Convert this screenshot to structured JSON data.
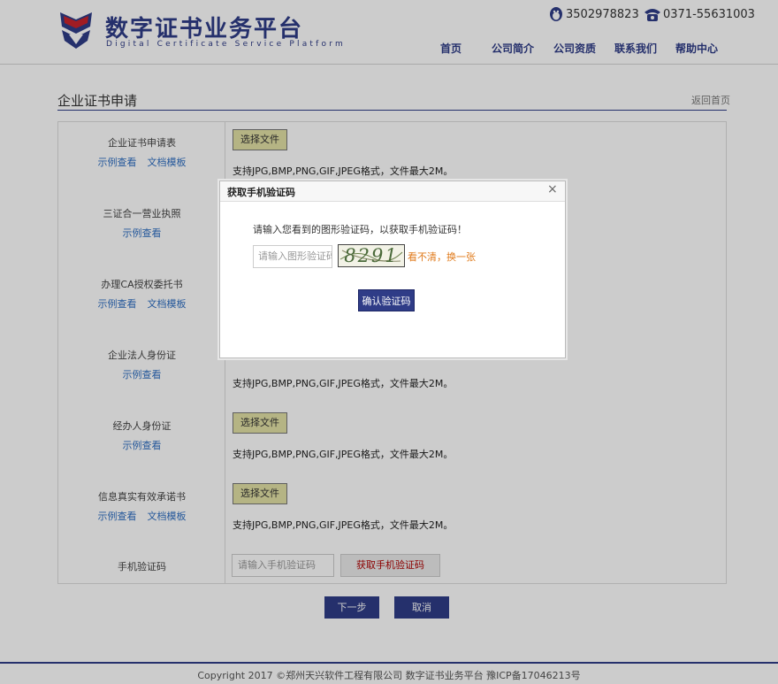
{
  "header": {
    "brand_title": "数字证书业务平台",
    "brand_subtitle": "Digital Certificate Service Platform",
    "qq": "3502978823",
    "phone": "0371-55631003",
    "nav": [
      "首页",
      "公司简介",
      "公司资质",
      "联系我们",
      "帮助中心"
    ]
  },
  "page": {
    "title": "企业证书申请",
    "back_label": "返回首页"
  },
  "form": {
    "rows": [
      {
        "label": "企业证书申请表",
        "example": "示例查看",
        "template": "文档模板",
        "button": "选择文件",
        "hint": "支持JPG,BMP,PNG,GIF,JPEG格式，文件最大2M。"
      },
      {
        "label": "三证合一营业执照",
        "example": "示例查看"
      },
      {
        "label": "办理CA授权委托书",
        "example": "示例查看",
        "template": "文档模板"
      },
      {
        "label": "企业法人身份证",
        "example": "示例查看",
        "hint": "支持JPG,BMP,PNG,GIF,JPEG格式，文件最大2M。"
      },
      {
        "label": "经办人身份证",
        "example": "示例查看",
        "button": "选择文件",
        "hint": "支持JPG,BMP,PNG,GIF,JPEG格式，文件最大2M。"
      },
      {
        "label": "信息真实有效承诺书",
        "example": "示例查看",
        "template": "文档模板",
        "button": "选择文件",
        "hint": "支持JPG,BMP,PNG,GIF,JPEG格式，文件最大2M。"
      }
    ],
    "sms": {
      "label": "手机验证码",
      "placeholder": "请输入手机验证码",
      "button": "获取手机验证码"
    }
  },
  "actions": {
    "next": "下一步",
    "cancel": "取消"
  },
  "footer": {
    "text": "Copyright 2017 ©郑州天兴软件工程有限公司 数字证书业务平台 豫ICP备17046213号"
  },
  "modal": {
    "title": "获取手机验证码",
    "close": "×",
    "message": "请输入您看到的图形验证码，以获取手机验证码！",
    "captcha_placeholder": "请输入图形验证码",
    "captcha_text": "8291",
    "refresh_label": "看不清，换一张",
    "confirm_label": "确认验证码"
  },
  "colors": {
    "brand": "#2f3c87",
    "link": "#2f6fc2",
    "file_button": "#e3e1a6",
    "alert_text": "#b00000",
    "refresh_text": "#e07a1a"
  },
  "icons": [
    "shield-logo-icon",
    "qq-penguin-icon",
    "telephone-icon",
    "close-icon"
  ]
}
